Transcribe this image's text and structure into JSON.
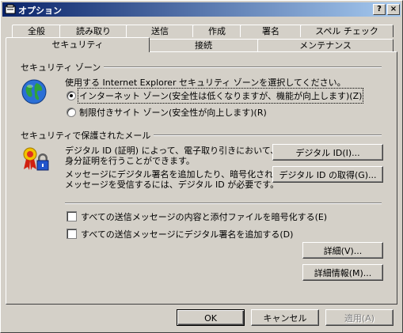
{
  "window": {
    "title": "オプション",
    "help_button": "?",
    "close_button": "×"
  },
  "tabs_row1": [
    "全般",
    "読み取り",
    "送信",
    "作成",
    "署名",
    "スペル チェック"
  ],
  "tabs_row2": [
    "セキュリティ",
    "接続",
    "メンテナンス"
  ],
  "security_zone": {
    "group_title": "セキュリティ ゾーン",
    "description": "使用する Internet Explorer セキュリティ ゾーンを選択してください。",
    "option_internet": "インターネット ゾーン(安全性は低くなりますが、機能が向上します)(Z)",
    "option_restricted": "制限付きサイト ゾーン(安全性が向上します)(R)"
  },
  "secure_mail": {
    "group_title": "セキュリティで保護されたメール",
    "digital_id_text_line1": "デジタル ID (証明) によって、電子取り引きにおいて、",
    "digital_id_text_line2": "身分証明を行うことができます。",
    "digital_id_button": "デジタル ID(I)...",
    "signature_text_line1": "メッセージにデジタル署名を追加したり、暗号化された",
    "signature_text_line2": "メッセージを受信するには、デジタル ID が必要です。",
    "get_digital_id_button": "デジタル ID の取得(G)...",
    "encrypt_checkbox": "すべての送信メッセージの内容と添付ファイルを暗号化する(E)",
    "sign_checkbox": "すべての送信メッセージにデジタル署名を追加する(D)",
    "advanced_button": "詳細(V)...",
    "details_button": "詳細情報(M)..."
  },
  "footer": {
    "ok": "OK",
    "cancel": "キャンセル",
    "apply": "適用(A)"
  }
}
